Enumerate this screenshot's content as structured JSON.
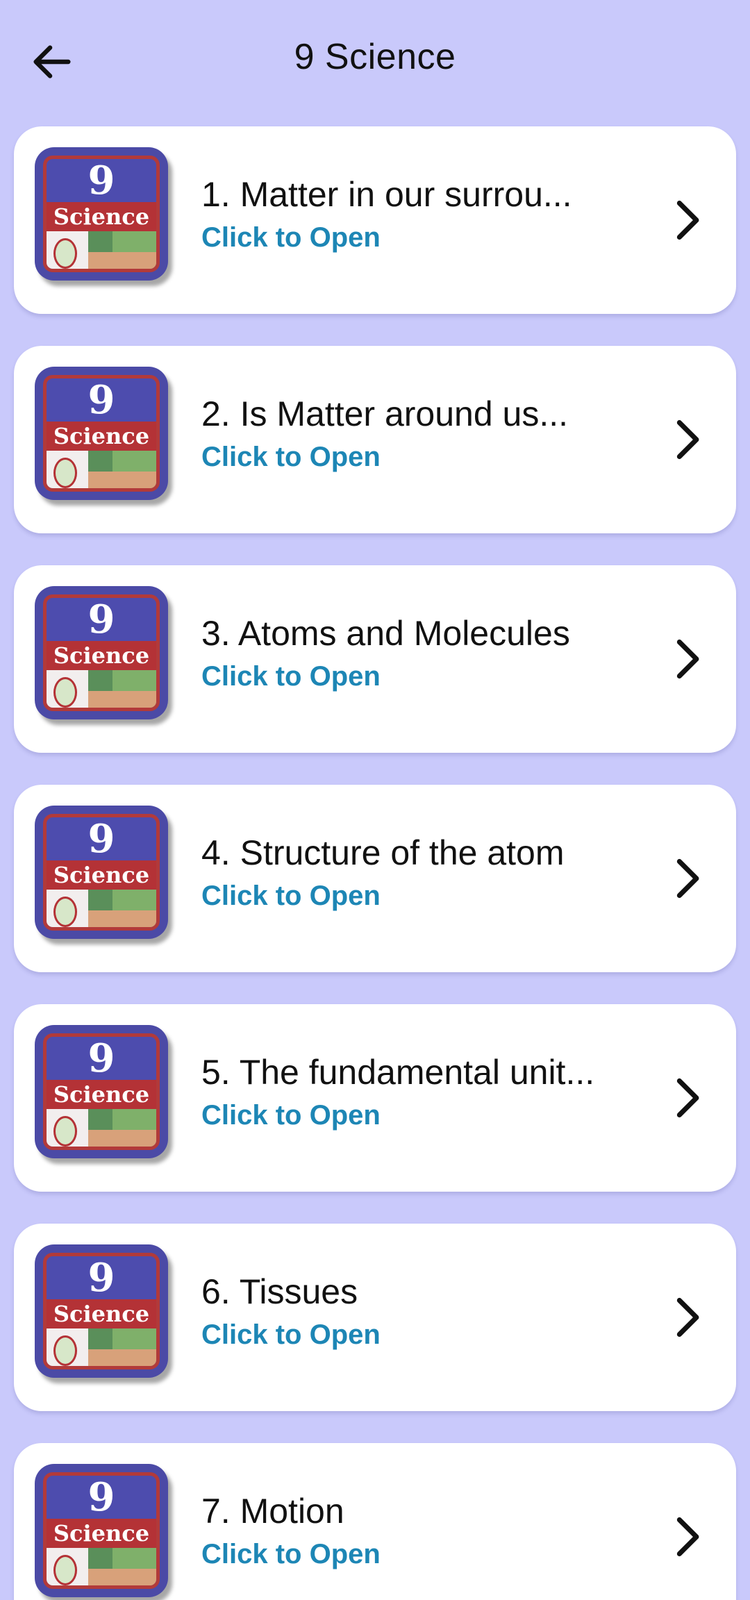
{
  "header": {
    "title": "9 Science",
    "back_icon": "arrow-left-icon"
  },
  "thumbnail": {
    "number": "9",
    "label": "Science",
    "colors": {
      "frame": "#4b4aa6",
      "border": "#b23a3a",
      "band": "#b43236"
    }
  },
  "accent": "#1d86b5",
  "chapters": [
    {
      "title": "1. Matter in our surrou...",
      "subtitle": "Click to Open"
    },
    {
      "title": "2. Is Matter around us...",
      "subtitle": "Click to Open"
    },
    {
      "title": "3. Atoms and Molecules",
      "subtitle": "Click to Open"
    },
    {
      "title": "4. Structure of the atom",
      "subtitle": "Click to Open"
    },
    {
      "title": "5. The fundamental unit...",
      "subtitle": "Click to Open"
    },
    {
      "title": "6. Tissues",
      "subtitle": "Click to Open"
    },
    {
      "title": "7. Motion",
      "subtitle": "Click to Open"
    }
  ]
}
